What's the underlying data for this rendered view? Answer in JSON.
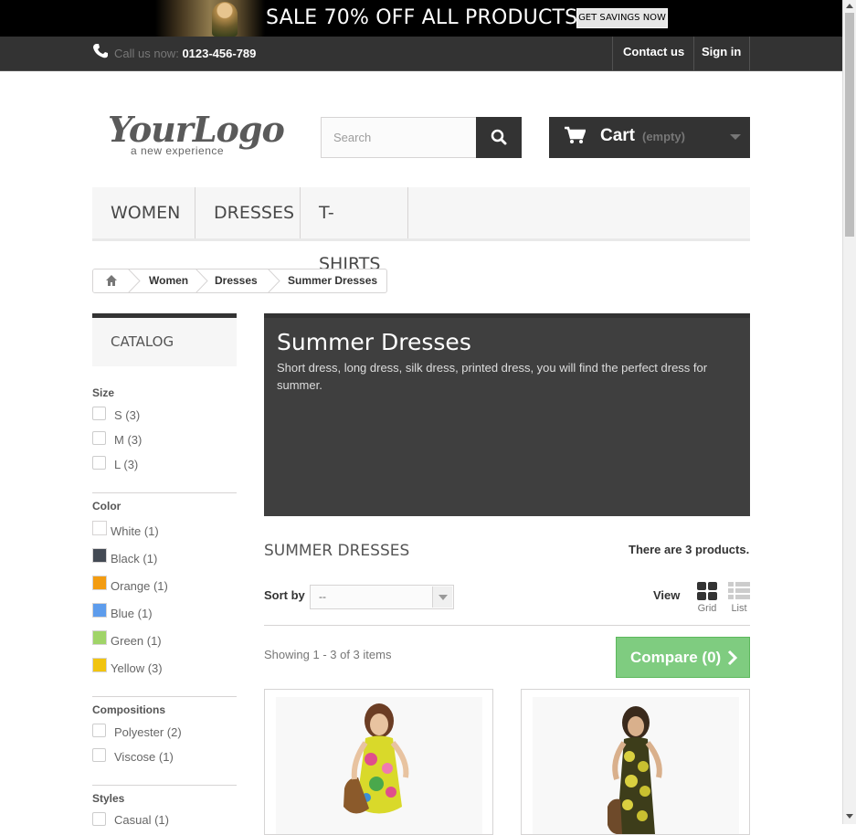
{
  "banner": {
    "sale_text": "SALE 70% OFF ALL PRODUCTS",
    "button_label": "GET SAVINGS NOW"
  },
  "topnav": {
    "call_label": "Call us now:",
    "phone": "0123-456-789",
    "contact_label": "Contact us",
    "signin_label": "Sign in"
  },
  "logo": {
    "main": "YourLogo",
    "sub": "a new experience"
  },
  "search": {
    "placeholder": "Search"
  },
  "cart": {
    "label": "Cart",
    "status": "(empty)"
  },
  "menu": {
    "items": [
      {
        "label": "WOMEN"
      },
      {
        "label": "DRESSES"
      },
      {
        "label": "T-SHIRTS"
      }
    ]
  },
  "breadcrumb": {
    "items": [
      "Women",
      "Dresses",
      "Summer Dresses"
    ]
  },
  "sidebar": {
    "catalog_title": "CATALOG",
    "size": {
      "title": "Size",
      "options": [
        {
          "label": "S (3)"
        },
        {
          "label": "M (3)"
        },
        {
          "label": "L (3)"
        }
      ]
    },
    "color": {
      "title": "Color",
      "options": [
        {
          "label": "White (1)",
          "color": "#ffffff"
        },
        {
          "label": "Black (1)",
          "color": "#434a54"
        },
        {
          "label": "Orange (1)",
          "color": "#f39c11"
        },
        {
          "label": "Blue (1)",
          "color": "#5d9cec"
        },
        {
          "label": "Green (1)",
          "color": "#a0d468"
        },
        {
          "label": "Yellow (3)",
          "color": "#f1c40f"
        }
      ]
    },
    "compositions": {
      "title": "Compositions",
      "options": [
        {
          "label": "Polyester (2)"
        },
        {
          "label": "Viscose (1)"
        }
      ]
    },
    "styles": {
      "title": "Styles",
      "options": [
        {
          "label": "Casual (1)"
        }
      ]
    }
  },
  "category": {
    "title": "Summer Dresses",
    "description": "Short dress, long dress, silk dress, printed dress, you will find the perfect dress for summer."
  },
  "listing": {
    "heading": "SUMMER DRESSES",
    "count": "There are 3 products.",
    "sort_label": "Sort by",
    "sort_value": "--",
    "view_label": "View",
    "grid_label": "Grid",
    "list_label": "List",
    "showing": "Showing 1 - 3 of 3 items",
    "compare_label": "Compare (0)"
  },
  "colors": {
    "dark": "#333333",
    "compare_green": "#7fcc80",
    "banner_bg": "#3f3f3f"
  }
}
